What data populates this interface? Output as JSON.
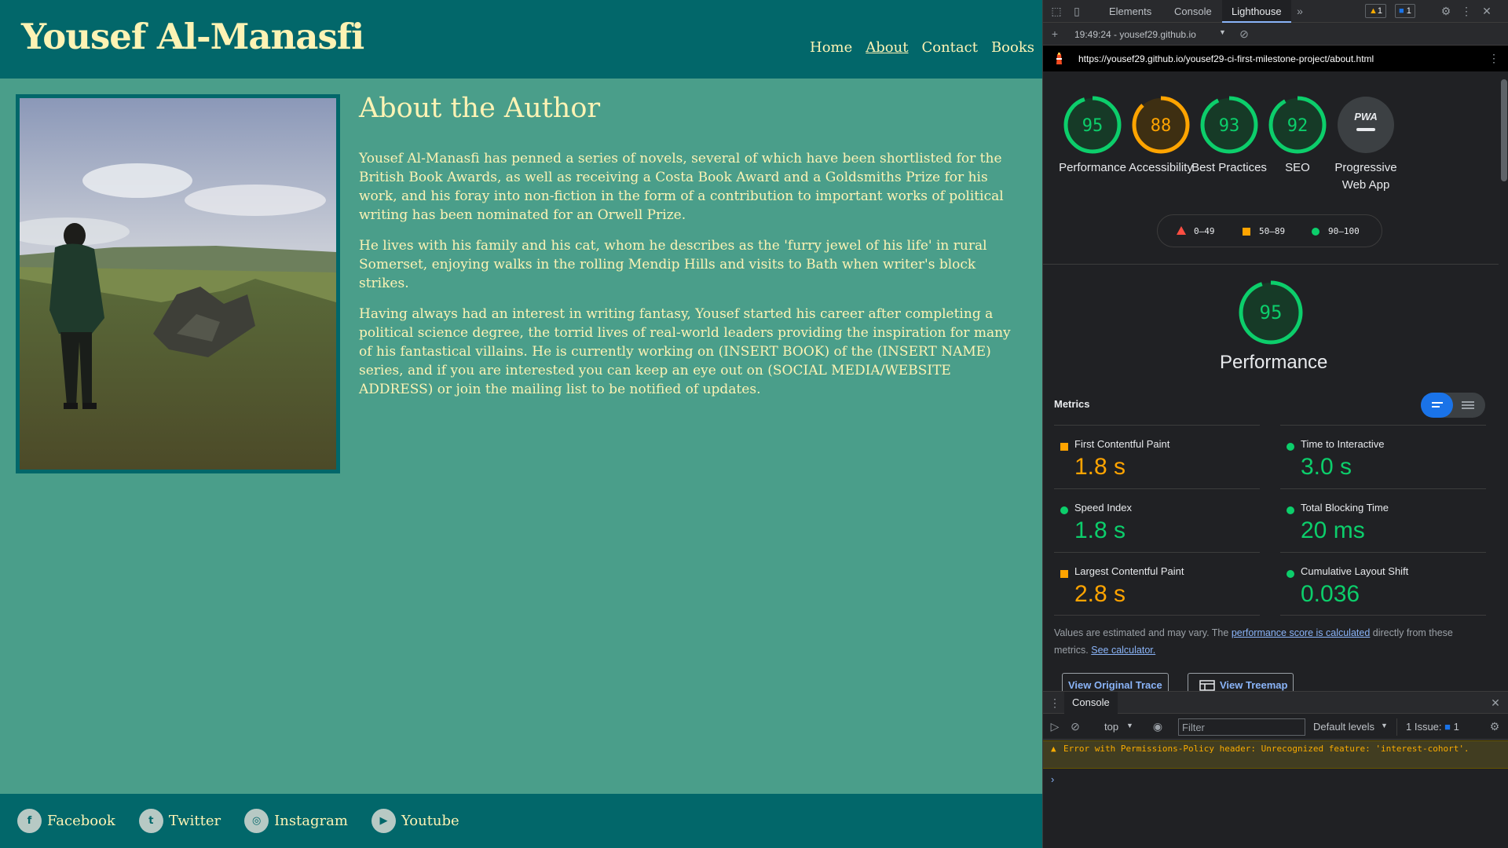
{
  "site": {
    "title": "Yousef Al-Manasfi",
    "nav": [
      "Home",
      "About",
      "Contact",
      "Books"
    ],
    "heading": "About the Author",
    "paragraphs": [
      "Yousef Al-Manasfi has penned a series of novels, several of which have been shortlisted for the British Book Awards, as well as receiving a Costa Book Award and a Goldsmiths Prize for his work, and his foray into non-fiction in the form of a contribution to important works of political writing has been nominated for an Orwell Prize.",
      "He lives with his family and his cat, whom he describes as the 'furry jewel of his life' in rural Somerset, enjoying walks in the rolling Mendip Hills and visits to Bath when writer's block strikes.",
      "Having always had an interest in writing fantasy, Yousef started his career after completing a political science degree, the torrid lives of real-world leaders providing the inspiration for many of his fantastical villains. He is currently working on (INSERT BOOK) of the (INSERT NAME) series, and if you are interested you can keep an eye out on (SOCIAL MEDIA/WEBSITE ADDRESS) or join the mailing list to be notified of updates."
    ],
    "social": [
      {
        "label": "Facebook",
        "icon": "facebook-icon",
        "glyph": "f"
      },
      {
        "label": "Twitter",
        "icon": "twitter-icon",
        "glyph": "t"
      },
      {
        "label": "Instagram",
        "icon": "instagram-icon",
        "glyph": "◎"
      },
      {
        "label": "Youtube",
        "icon": "youtube-icon",
        "glyph": "▶"
      }
    ],
    "colors": {
      "header": "#02676a",
      "body": "#4a9e8a",
      "text": "#fdf3b4"
    }
  },
  "devtools": {
    "tabs": [
      "Elements",
      "Console",
      "Lighthouse"
    ],
    "more_tabs": "»",
    "warnings_count": "1",
    "issues_count": "1",
    "report_label": "19:49:24 - yousef29.github.io",
    "url": "https://yousef29.github.io/yousef29-ci-first-milestone-project/about.html",
    "gauges": [
      {
        "label": "Performance",
        "score": 95,
        "status": "pass"
      },
      {
        "label": "Accessibility",
        "score": 88,
        "status": "average"
      },
      {
        "label": "Best Practices",
        "score": 93,
        "status": "pass"
      },
      {
        "label": "SEO",
        "score": 92,
        "status": "pass"
      },
      {
        "label": "Progressive Web App",
        "score": "PWA",
        "status": "na"
      }
    ],
    "legend": [
      "0–49",
      "50–89",
      "90–100"
    ],
    "perf_score": 95,
    "perf_title": "Performance",
    "metrics_title": "Metrics",
    "metrics": [
      {
        "name": "First Contentful Paint",
        "value": "1.8 s",
        "status": "average"
      },
      {
        "name": "Time to Interactive",
        "value": "3.0 s",
        "status": "pass"
      },
      {
        "name": "Speed Index",
        "value": "1.8 s",
        "status": "pass"
      },
      {
        "name": "Total Blocking Time",
        "value": "20 ms",
        "status": "pass"
      },
      {
        "name": "Largest Contentful Paint",
        "value": "2.8 s",
        "status": "average"
      },
      {
        "name": "Cumulative Layout Shift",
        "value": "0.036",
        "status": "pass"
      }
    ],
    "note_pre": "Values are estimated and may vary. The ",
    "note_link1": "performance score is calculated",
    "note_mid": " directly from these metrics. ",
    "note_link2": "See calculator.",
    "btn_trace": "View Original Trace",
    "btn_treemap": "View Treemap",
    "drawer_tab": "Console",
    "context": "top",
    "filter_placeholder": "Filter",
    "levels": "Default levels",
    "issue_label": "1 Issue:",
    "issue_count": "1",
    "warning_message": "Error with Permissions-Policy header: Unrecognized feature: 'interest-cohort'.",
    "colors": {
      "pass": "#0cce6b",
      "average": "#ffa400",
      "fail": "#ff4e42",
      "link": "#8ab4f8"
    }
  }
}
